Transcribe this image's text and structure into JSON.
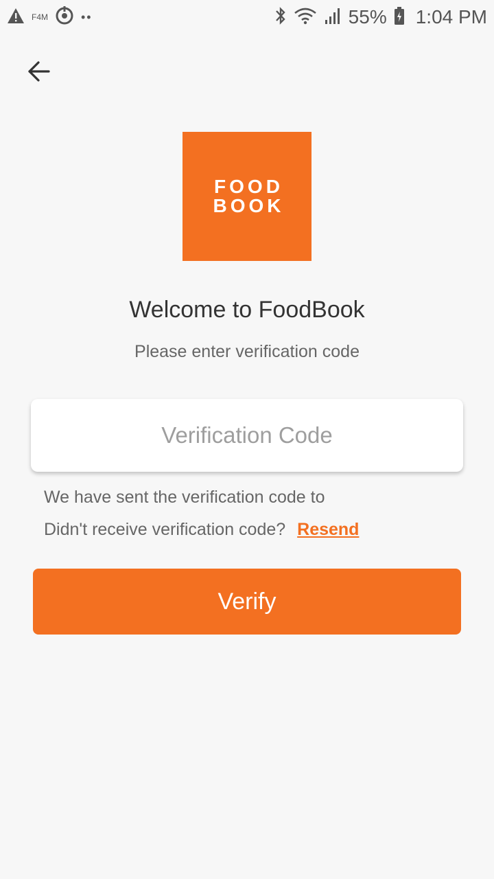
{
  "status_bar": {
    "carrier_badge": "F4M",
    "battery_percent": "55%",
    "time": "1:04 PM",
    "icons": [
      "warning-icon",
      "sync-icon",
      "more-dots-icon",
      "bluetooth-icon",
      "wifi-icon",
      "signal-icon",
      "battery-icon"
    ]
  },
  "header": {
    "back_icon": "arrow-left-icon"
  },
  "logo": {
    "line1": "FOOD",
    "line2": "BOOK",
    "color": "#f37021"
  },
  "content": {
    "title": "Welcome to FoodBook",
    "subtitle": "Please enter verification code",
    "input_placeholder": "Verification Code",
    "input_value": "",
    "sent_text": "We have sent the verification code to",
    "didnt_receive_text": "Didn't receive verification code?",
    "resend_label": "Resend",
    "verify_label": "Verify"
  },
  "colors": {
    "accent": "#f37021",
    "background": "#f7f7f7",
    "text_dark": "#333333",
    "text_muted": "#666666"
  }
}
